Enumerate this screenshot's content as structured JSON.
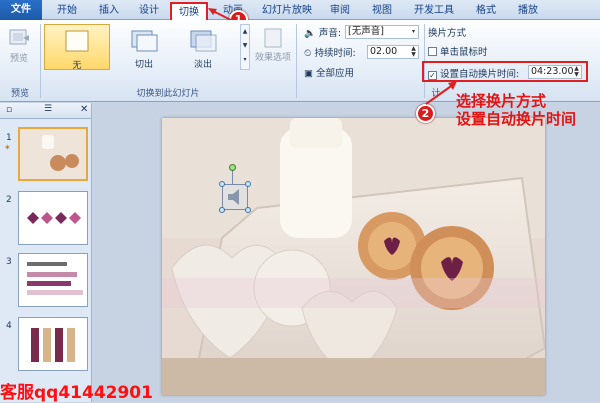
{
  "tabs": {
    "file": "文件",
    "home": "开始",
    "insert": "插入",
    "design": "设计",
    "transitions": "切换",
    "animations": "动画",
    "slideshow": "幻灯片放映",
    "review": "审阅",
    "view": "视图",
    "developer": "开发工具",
    "format": "格式",
    "playback": "播放"
  },
  "ribbon": {
    "preview_label": "预览",
    "preview_group": "预览",
    "transitions_group": "切换到此幻灯片",
    "gallery": [
      {
        "label": "无"
      },
      {
        "label": "切出"
      },
      {
        "label": "淡出"
      }
    ],
    "effect_options_label": "效果选项",
    "sound_label": "声音:",
    "sound_value": "[无声音]",
    "duration_label": "持续时间:",
    "duration_value": "02.00",
    "apply_all_label": "全部应用",
    "advance_title": "换片方式",
    "on_click_label": "单击鼠标时",
    "after_label": "设置自动换片时间:",
    "after_value": "04:23.00",
    "timing_group_partial": "计"
  },
  "slides_panel": {
    "thumbnails": [
      {
        "number": "1"
      },
      {
        "number": "2"
      },
      {
        "number": "3"
      },
      {
        "number": "4"
      }
    ]
  },
  "annotations": {
    "marker1": "1",
    "marker2": "2",
    "line1": "选择换片方式",
    "line2": "设置自动换片时间",
    "watermark": "客服qq41442901"
  },
  "colors": {
    "accent": "#e02020",
    "ribbon_blue": "#1e395b",
    "selected_gallery": "#ffd86a"
  }
}
